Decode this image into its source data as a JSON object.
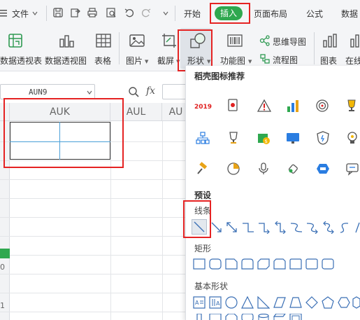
{
  "menubar": {
    "file_label": "文件",
    "file_menu_icon": "hamburger-icon",
    "tabs": [
      "开始",
      "插入",
      "页面布局",
      "公式",
      "数据"
    ],
    "active_tab": "插入",
    "accent_color": "#2fa84f"
  },
  "ribbon": {
    "items": [
      {
        "label": "数据透视表",
        "icon": "pivot-table-icon"
      },
      {
        "label": "数据透视图",
        "icon": "pivot-chart-icon"
      },
      {
        "label": "表格",
        "icon": "table-icon"
      },
      {
        "label": "图片",
        "icon": "image-icon"
      },
      {
        "label": "截屏",
        "icon": "screenshot-icon"
      },
      {
        "label": "形状",
        "icon": "shapes-icon"
      },
      {
        "label": "功能图",
        "icon": "barcode-icon"
      },
      {
        "label": "思维导图",
        "icon": "mindmap-icon"
      },
      {
        "label": "流程图",
        "icon": "flowchart-icon"
      },
      {
        "label": "图表",
        "icon": "chart-icon"
      },
      {
        "label": "在线",
        "icon": "online-chart-icon"
      }
    ]
  },
  "formula_bar": {
    "name_box_value": "AUN9",
    "fx_label": "fx"
  },
  "sheet": {
    "columns": [
      "AUK",
      "AUL",
      "AU"
    ],
    "row_labels": [
      "0",
      "1"
    ]
  },
  "shapes_panel": {
    "section_recommended": "稻壳图标推荐",
    "recommended_badge": "2019",
    "section_preset": "预设",
    "cat_lines": "线条",
    "cat_rect": "矩形",
    "cat_basic": "基本形状"
  },
  "highlight_color": "#e52323"
}
